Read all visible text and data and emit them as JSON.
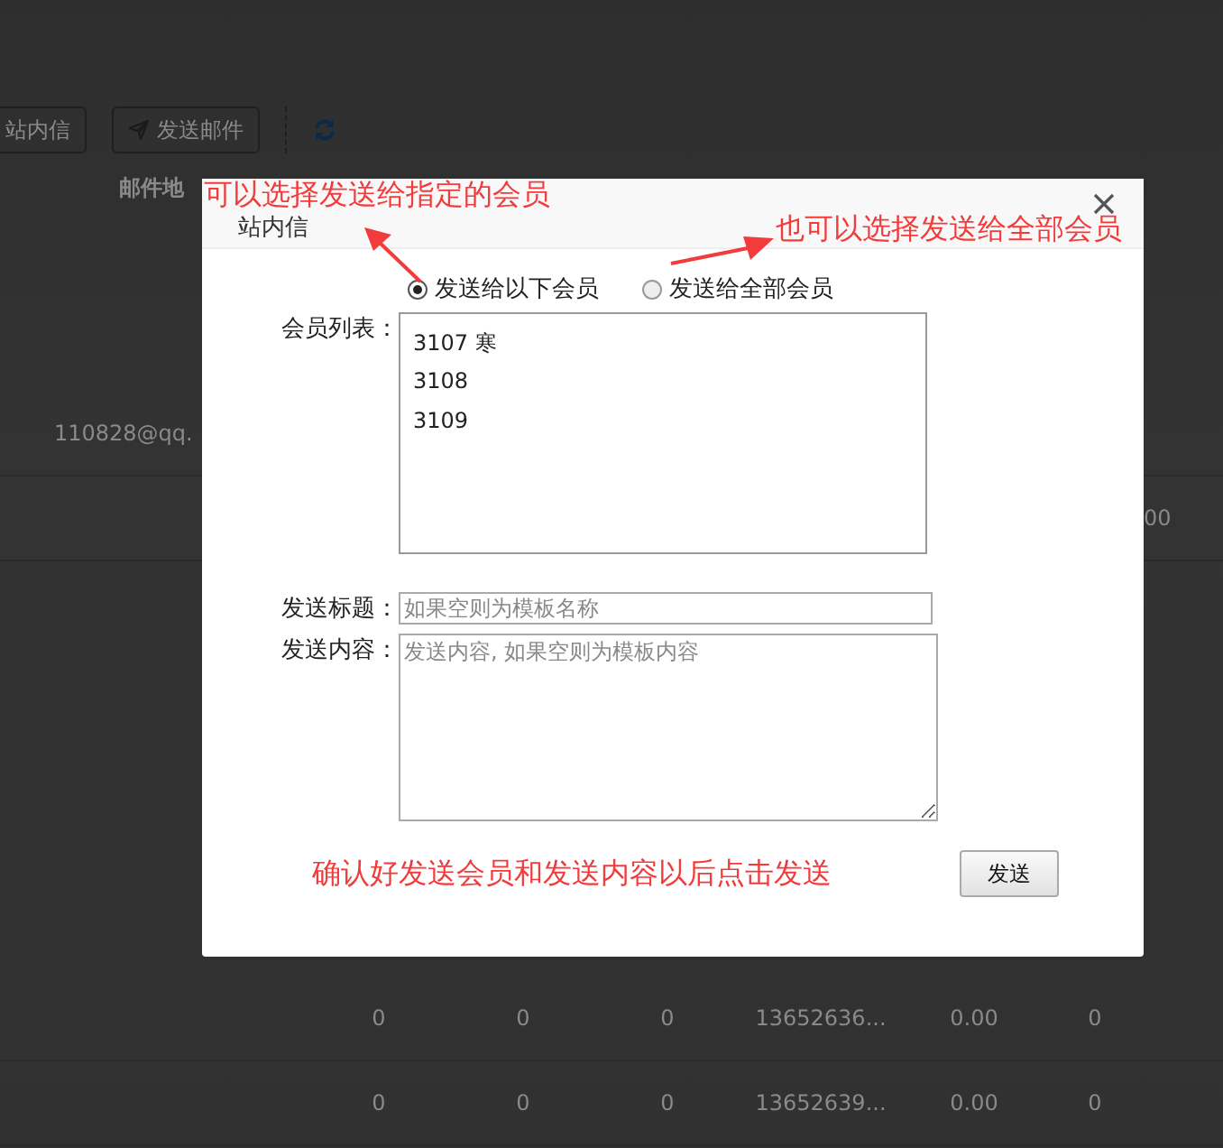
{
  "toolbar": {
    "buttons": [
      {
        "label": "站内信",
        "kind": "plain"
      },
      {
        "label": "发送邮件",
        "kind": "send"
      },
      {
        "kind": "refresh"
      }
    ]
  },
  "table": {
    "header": "邮件地",
    "rows": [
      {
        "column_1": "110828@qq."
      },
      {
        "column_8": "00"
      },
      {
        "column_2": "0",
        "column_3": "0",
        "column_4": "0",
        "column_5": "13652636...",
        "column_6": "0.00",
        "column_7": "0"
      },
      {
        "column_2": "0",
        "column_3": "0",
        "column_4": "0",
        "column_5": "13652639...",
        "column_6": "0.00",
        "column_7": "0"
      }
    ]
  },
  "dialog": {
    "title": "站内信",
    "annotations": [
      {
        "text": "可以选择发送给指定的会员",
        "kind": "pointer_up_left"
      },
      {
        "text": "也可以选择发送给全部会员",
        "kind": "pointer_up_right"
      }
    ],
    "recipients": [
      {
        "label": "发送给以下会员",
        "selected": true
      },
      {
        "label": "发送给全部会员",
        "selected": false
      }
    ],
    "member_list": {
      "label": "会员列表：",
      "items": [
        "3107 寒",
        "3108",
        "3109"
      ]
    },
    "subject": {
      "label": "发送标题：",
      "placeholder": "如果空则为模板名称"
    },
    "content": {
      "label": "发送内容：",
      "placeholder": "发送内容, 如果空则为模板内容"
    },
    "footer_note": "确认好发送会员和发送内容以后点击发送",
    "send_button": "发送"
  }
}
